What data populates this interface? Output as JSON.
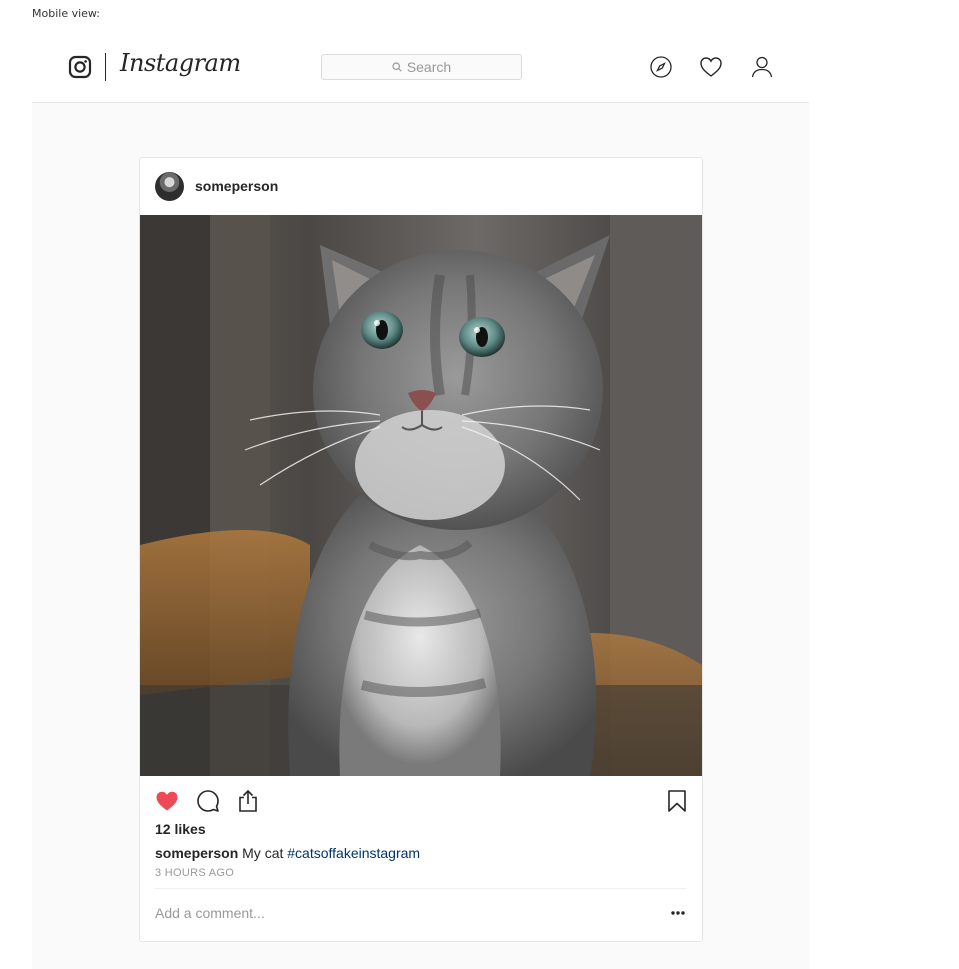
{
  "page": {
    "label": "Mobile view:"
  },
  "nav": {
    "logo_text": "Instagram",
    "search_placeholder": "Search",
    "icons": [
      "camera-icon",
      "compass-icon",
      "heart-icon",
      "user-icon"
    ]
  },
  "post": {
    "username": "someperson",
    "liked": true,
    "likes_text": "12 likes",
    "caption_user": "someperson",
    "caption_text": "My cat",
    "hashtag": "#catsoffakeinstagram",
    "timestamp": "3 HOURS AGO",
    "comment_placeholder": "Add a comment...",
    "more_label": "...",
    "photo_subject": "grey kitten"
  },
  "colors": {
    "like_red": "#ed4956",
    "hashtag_blue": "#003569",
    "border": "#e6e6e6",
    "background": "#fafafa"
  }
}
